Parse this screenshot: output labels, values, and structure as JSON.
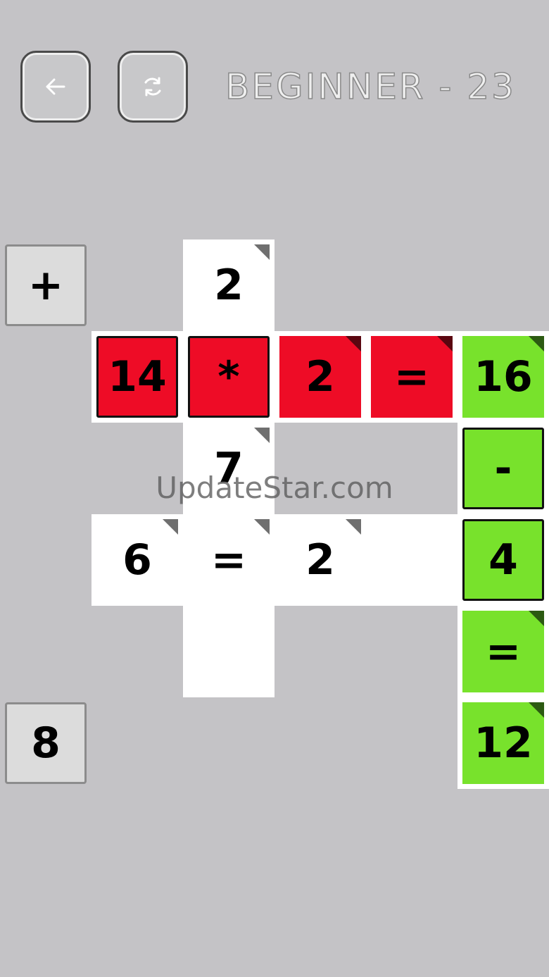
{
  "header": {
    "back_icon": "arrow-left-icon",
    "restart_icon": "refresh-icon",
    "level_title": "BEGINNER - 23"
  },
  "palette": {
    "background": "#c4c3c6",
    "slot": "#ffffff",
    "red": "#ee0c26",
    "green": "#78e22c"
  },
  "side_tiles": {
    "top": "+",
    "bottom": "8"
  },
  "board": {
    "r1c3": "2",
    "r2c2": "14",
    "r2c3": "*",
    "r2c4": "2",
    "r2c5": "=",
    "r2c6": "16",
    "r3c3": "7",
    "r3c6": "-",
    "r4c2": "6",
    "r4c3": "=",
    "r4c4": "2",
    "r4c6": "4",
    "r5c6": "=",
    "r6c6": "12"
  },
  "watermark": "UpdateStar.com"
}
